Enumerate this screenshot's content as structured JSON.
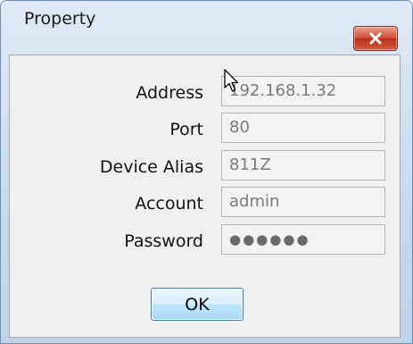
{
  "dialog": {
    "title": "Property",
    "close_icon": "close-x-icon",
    "close_color": "#c9452d"
  },
  "fields": {
    "address": {
      "label": "Address",
      "value": "192.168.1.32"
    },
    "port": {
      "label": "Port",
      "value": "80"
    },
    "alias": {
      "label": "Device Alias",
      "value": "811Z"
    },
    "account": {
      "label": "Account",
      "value": "admin"
    },
    "password": {
      "label": "Password",
      "value": "●●●●●●"
    }
  },
  "buttons": {
    "ok_label": "OK"
  },
  "icons": {
    "cursor": "mouse-pointer-icon"
  }
}
